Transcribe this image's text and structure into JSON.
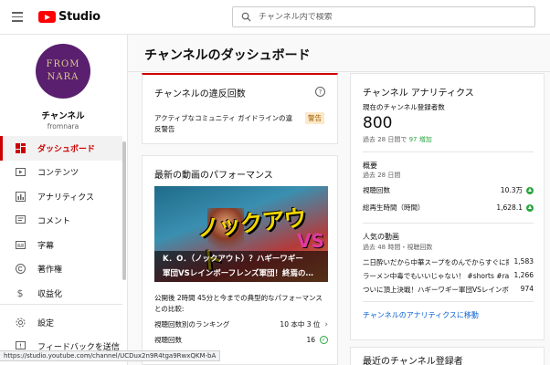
{
  "header": {
    "logo_text": "Studio",
    "search_placeholder": "チャンネル内で検索"
  },
  "sidebar": {
    "avatar_lines": [
      "FROM",
      "NARA"
    ],
    "channel_name": "チャンネル",
    "channel_handle": "fromnara",
    "items": [
      {
        "label": "ダッシュボード",
        "icon": "dashboard-icon",
        "active": true
      },
      {
        "label": "コンテンツ",
        "icon": "content-icon"
      },
      {
        "label": "アナリティクス",
        "icon": "analytics-icon"
      },
      {
        "label": "コメント",
        "icon": "comment-icon"
      },
      {
        "label": "字幕",
        "icon": "subtitles-icon"
      },
      {
        "label": "著作権",
        "icon": "copyright-icon"
      },
      {
        "label": "収益化",
        "icon": "dollar-icon"
      }
    ],
    "bottom_items": [
      {
        "label": "設定",
        "icon": "gear-icon"
      },
      {
        "label": "フィードバックを送信",
        "icon": "feedback-icon"
      }
    ]
  },
  "main": {
    "page_title": "チャンネルのダッシュボード",
    "violations": {
      "title": "チャンネルの違反回数",
      "text": "アクティブなコミュニティ ガイドラインの違反警告",
      "badge": "警告"
    },
    "performance": {
      "title": "最新の動画のパフォーマンス",
      "thumb_big": "ノックアウト",
      "thumb_vs": "VS",
      "thumb_line1": "K．O．（ノックアウト）？ハギーワギー",
      "thumb_line2": "軍団VSレインボーフレンズ軍団！終焉の…",
      "description": "公開後 2時間 45分と今までの典型的なパフォーマンスとの比較:",
      "rows": [
        {
          "label": "視聴回数別のランキング",
          "value": "10 本中 3 位"
        },
        {
          "label": "視聴回数",
          "value": "16"
        }
      ]
    },
    "analytics": {
      "title": "チャンネル アナリティクス",
      "subscribers_label": "現在のチャンネル登録者数",
      "subscribers_count": "800",
      "change_prefix": "過去 28 日間で",
      "change_value": "97 増加",
      "summary_title": "概要",
      "summary_period": "過去 28 日間",
      "summary_rows": [
        {
          "label": "視聴回数",
          "value": "10.3万"
        },
        {
          "label": "総再生時間（時間）",
          "value": "1,628.1"
        }
      ],
      "popular_title": "人気の動画",
      "popular_period": "過去 48 時間・視聴回数",
      "popular_videos": [
        {
          "title": "二日酔いだから中華スープをのんでからすぐに揮…",
          "views": "1,583"
        },
        {
          "title": "ラーメン中毒でもいいじゃない！ #shorts #ramen …",
          "views": "1,266"
        },
        {
          "title": "ついに頂上決戦！ハギーワギー軍団VSレインボー…",
          "views": "974"
        }
      ],
      "link": "チャンネルのアナリティクスに移動"
    },
    "recent_subs": {
      "title": "最近のチャンネル登録者"
    }
  },
  "status_bar": {
    "url": "https://studio.youtube.com/channel/UCDux2n9R4tga9RwxQKM-bA"
  },
  "colors": {
    "accent": "#cc0000",
    "link": "#065fd4",
    "positive": "#2ba640"
  }
}
